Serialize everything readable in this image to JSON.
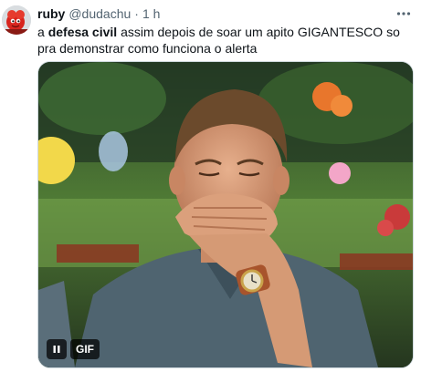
{
  "author": {
    "display_name": "ruby",
    "handle": "@dudachu",
    "separator": "·",
    "time": "1 h",
    "avatar_icon": "red-character-avatar"
  },
  "tweet": {
    "prefix": "a ",
    "bold_term": "defesa civil",
    "rest": " assim depois de soar um apito GIGANTESCO so pra demonstrar como funciona o alerta"
  },
  "media": {
    "type": "gif",
    "description_icon": "man-laughing-covering-mouth-gif",
    "badge_label": "GIF",
    "control_icon": "pause-icon"
  },
  "menu_icon": "more-options-icon",
  "colors": {
    "text_primary": "#0f1419",
    "text_secondary": "#536471",
    "border": "#cfd9de",
    "badge_bg": "#000000"
  }
}
